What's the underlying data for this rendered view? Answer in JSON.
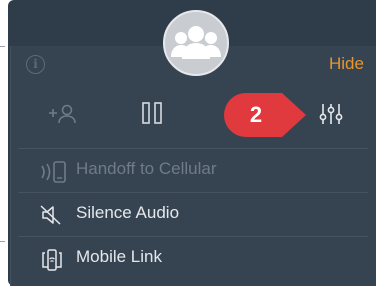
{
  "panel": {
    "hide_label": "Hide"
  },
  "badge": {
    "number": "2"
  },
  "menu": {
    "items": [
      {
        "label": "Handoff to Cellular",
        "enabled": false
      },
      {
        "label": "Silence Audio",
        "enabled": true
      },
      {
        "label": "Mobile Link",
        "enabled": true
      }
    ]
  },
  "icons": {
    "avatar": "group-icon",
    "info": "info-icon",
    "add_participant": "add-person-icon",
    "hold": "pause-icon",
    "settings": "equalizer-icon",
    "handoff": "phone-handoff-icon",
    "silence": "speaker-mute-icon",
    "mobile_link": "mobile-link-icon"
  },
  "colors": {
    "panel_bg": "#2f3c49",
    "accent": "#e8952e",
    "badge": "#e0393e",
    "text": "#e5e8eb",
    "disabled_text": "#6f7b86"
  }
}
